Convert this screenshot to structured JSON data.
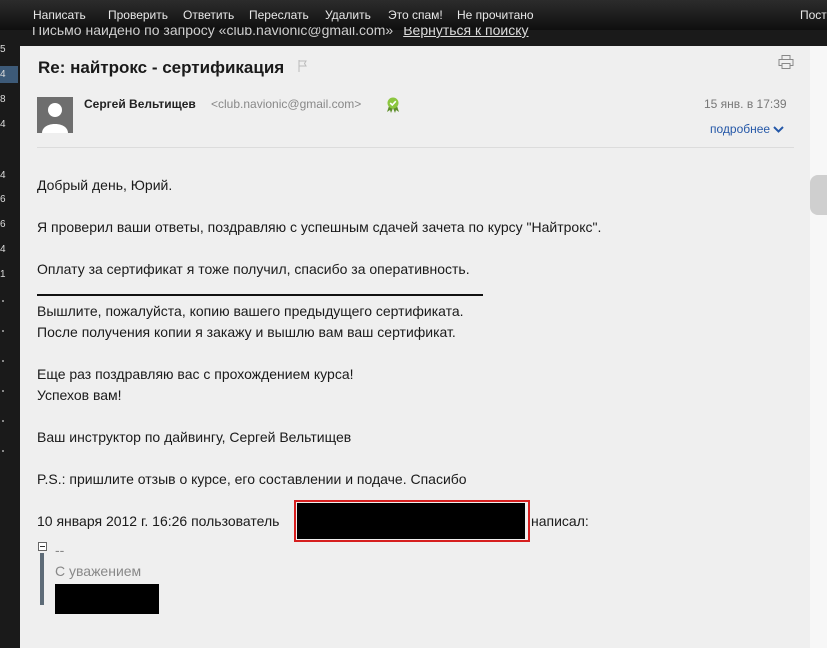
{
  "toolbar": {
    "compose": "Написать",
    "check": "Проверить",
    "reply": "Ответить",
    "forward": "Переслать",
    "delete": "Удалить",
    "spam": "Это спам!",
    "unread": "Не прочитано",
    "cut": "Пост"
  },
  "search_notice": {
    "text": "Письмо найдено по запросу «club.navionic@gmail.com»",
    "link": "Вернуться к поиску"
  },
  "left_numbers": [
    "5",
    "4",
    "8",
    "4",
    "4",
    "6",
    "6",
    "4",
    "1"
  ],
  "message": {
    "subject": "Re: найтрокс - сертификация",
    "sender_name": "Сергей Вельтищев",
    "sender_email": "<club.navionic@gmail.com>",
    "date": "15 янв. в 17:39",
    "details_link": "подробнее",
    "body": {
      "greeting": "Добрый день, Юрий.",
      "p1": "Я проверил ваши ответы, поздравляю с успешным сдачей зачета по курсу \"Найтрокс\".",
      "p2": "Оплату за сертификат я тоже получил, спасибо за оперативность.",
      "p3": "Вышлите, пожалуйста, копию вашего предыдущего сертификата.",
      "p4": "После получения копии я закажу и вышлю вам ваш сертификат.",
      "p5": "Еще раз поздравляю вас с прохождением курса!",
      "p6": "Успехов вам!",
      "p7": "Ваш инструктор по дайвингу, Сергей Вельтищев",
      "p8": "P.S.: пришлите отзыв о курсе, его составлении и подаче. Спасибо",
      "quote_intro": "10 января 2012 г. 16:26 пользователь",
      "quote_wrote": "написал:"
    },
    "quote": {
      "dashes": "--",
      "regards": "С уважением"
    }
  },
  "icons": {
    "flag": "flag-icon",
    "print": "print-icon",
    "avatar": "avatar-icon",
    "badge": "verified-badge-icon",
    "chevron": "chevron-down-icon"
  },
  "colors": {
    "link": "#2558a8",
    "redaction_border": "#d61f1f"
  }
}
